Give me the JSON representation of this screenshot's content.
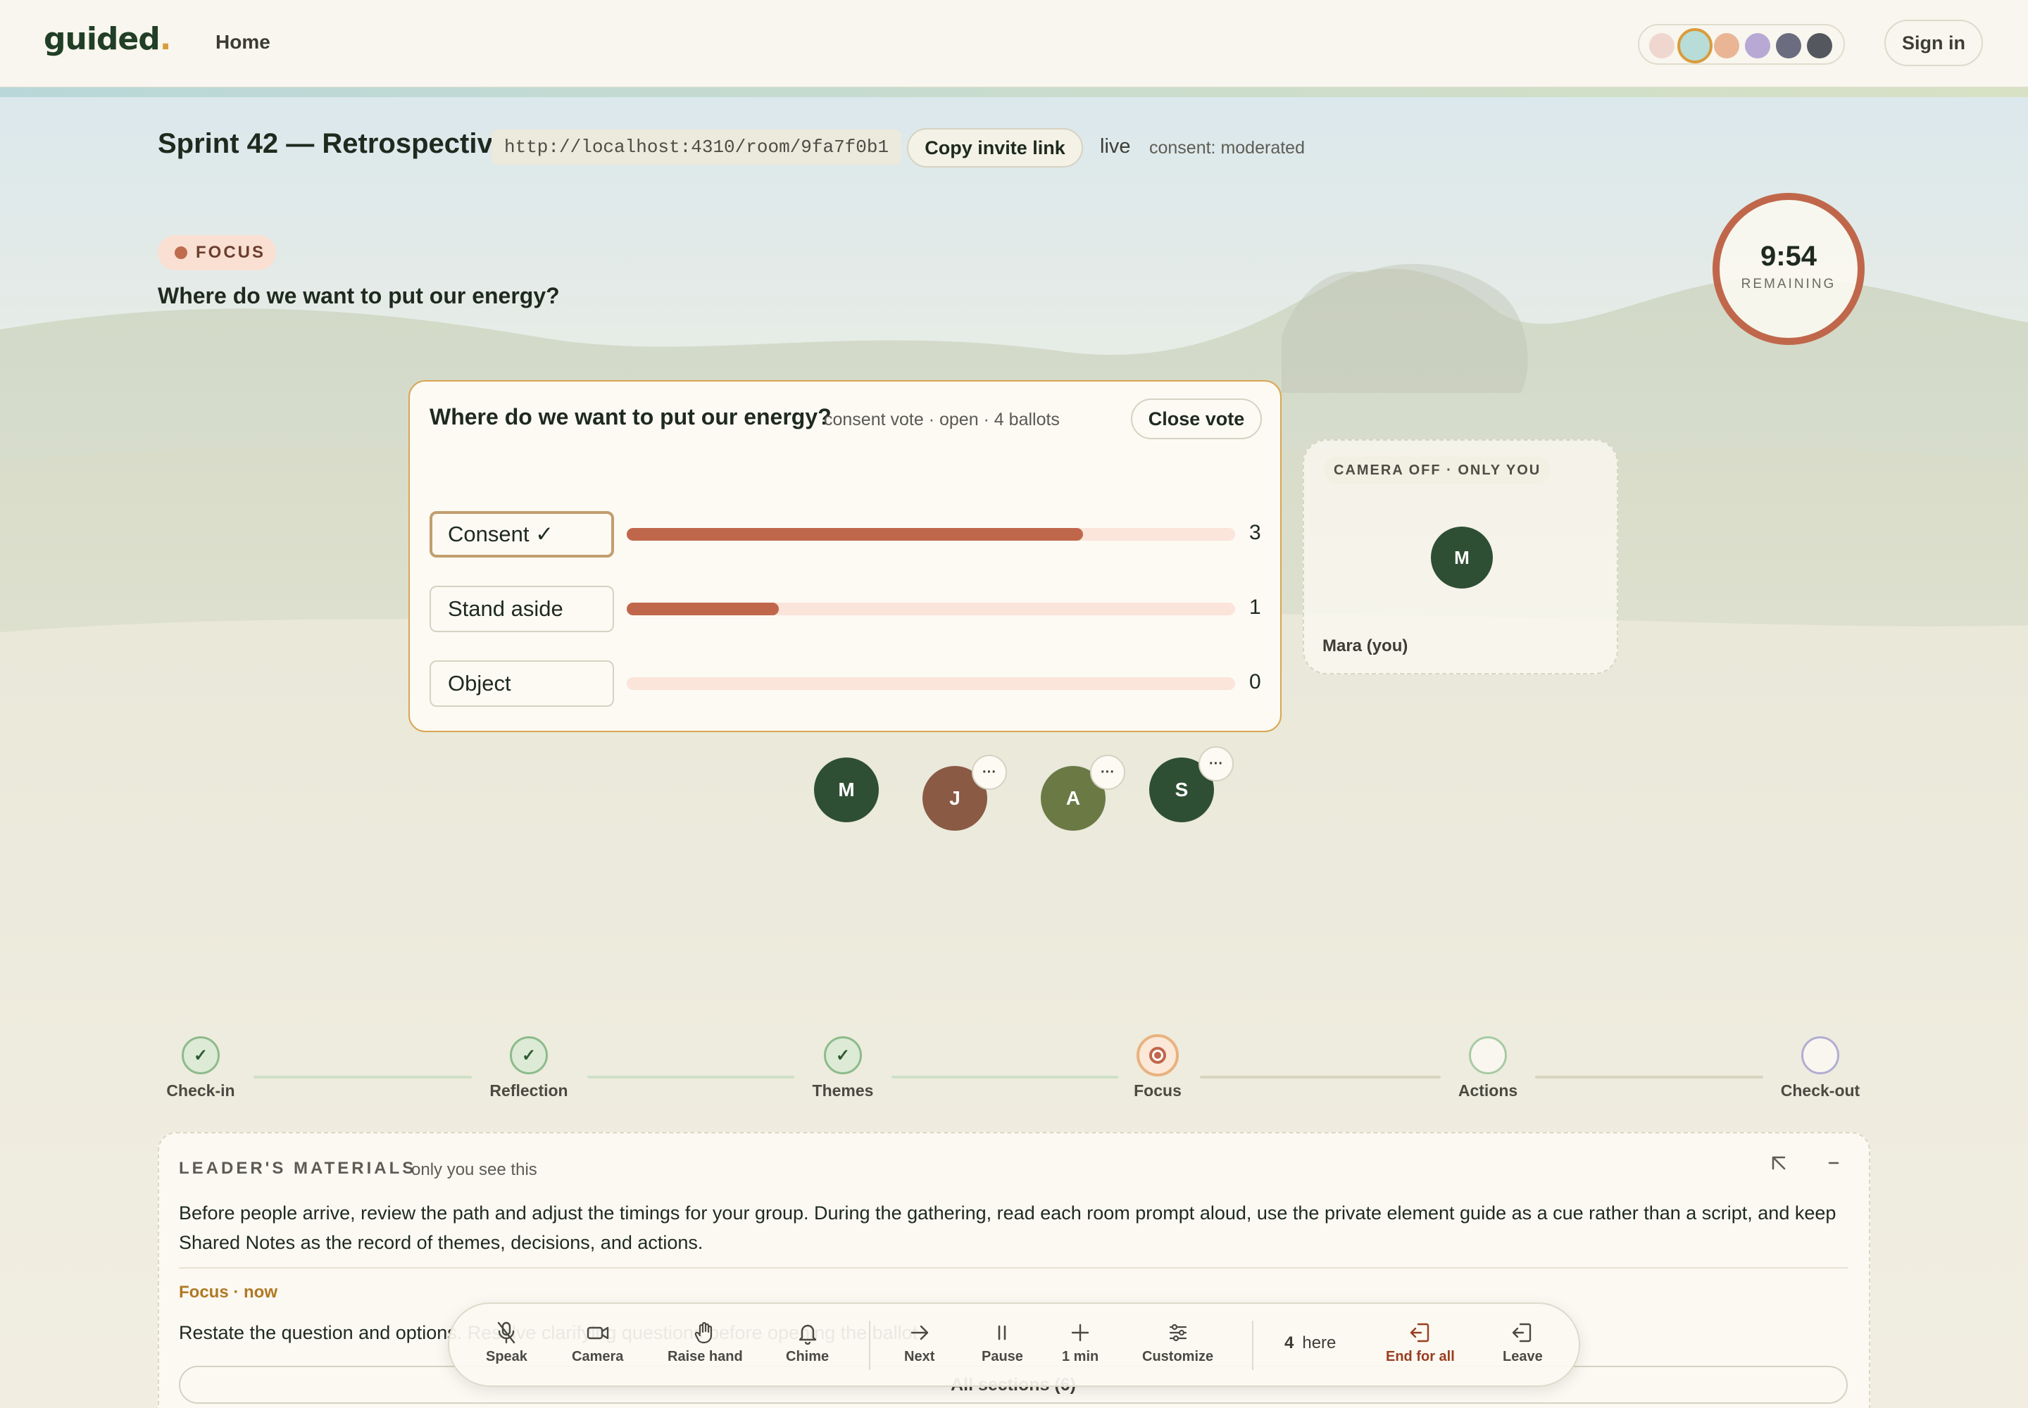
{
  "header": {
    "logo": "guided",
    "logo_dot": ".",
    "nav_home": "Home",
    "theme_swatches": [
      "#efd7cf",
      "#b8ddd8",
      "#e9b595",
      "#b7a9d4",
      "#6c6c80",
      "#54585e"
    ],
    "selected_swatch_index": 1,
    "sign_in": "Sign in"
  },
  "room": {
    "title": "Sprint 42 — Retrospective",
    "url": "http://localhost:4310/room/9fa7f0b1",
    "copy_invite": "Copy invite link",
    "status": "live",
    "consent_mode": "consent: moderated"
  },
  "stage": {
    "badge": "FOCUS",
    "prompt": "Where do we want to put our energy?",
    "timer": "9:54",
    "timer_label": "REMAINING",
    "timer_progress": 1.0
  },
  "vote": {
    "question": "Where do we want to put our energy?",
    "meta": "consent vote · open · 4 ballots",
    "close_label": "Close vote",
    "options": [
      {
        "label": "Consent ✓",
        "count": "3",
        "fraction": 0.75,
        "selected": true
      },
      {
        "label": "Stand aside",
        "count": "1",
        "fraction": 0.25,
        "selected": false
      },
      {
        "label": "Object",
        "count": "0",
        "fraction": 0,
        "selected": false
      }
    ]
  },
  "participants": [
    {
      "initial": "M",
      "color": "#2f4f34"
    },
    {
      "initial": "J",
      "color": "#8a5a45",
      "more": "···"
    },
    {
      "initial": "A",
      "color": "#6b7a45",
      "more": "···"
    },
    {
      "initial": "S",
      "color": "#2f4f34",
      "more": "···"
    }
  ],
  "self_camera": {
    "label": "CAMERA OFF · ONLY YOU",
    "initial": "M",
    "name": "Mara (you)"
  },
  "path": {
    "steps": [
      {
        "label": "Check-in",
        "state": "done",
        "mark": "✓"
      },
      {
        "label": "Reflection",
        "state": "done",
        "mark": "✓"
      },
      {
        "label": "Themes",
        "state": "done",
        "mark": "✓"
      },
      {
        "label": "Focus",
        "state": "current",
        "mark": ""
      },
      {
        "label": "Actions",
        "state": "todo",
        "mark": ""
      },
      {
        "label": "Check-out",
        "state": "todo",
        "mark": ""
      }
    ]
  },
  "materials": {
    "heading": "LEADER'S MATERIALS",
    "subheading": "only you see this",
    "body": "Before people arrive, review the path and adjust the timings for your group. During the gathering, read each room prompt aloud, use the private element guide as a cue rather than a script, and keep Shared Notes as the record of themes, decisions, and actions.",
    "section_label": "Focus · now",
    "section_text": "Restate the question and options. Resolve clarifying questions before opening the ballot.",
    "all_sections": "All sections (6)"
  },
  "dock": {
    "speak": "Speak",
    "camera": "Camera",
    "raise_hand": "Raise hand",
    "chime": "Chime",
    "next": "Next",
    "pause": "Pause",
    "add_min": "1 min",
    "customize": "Customize",
    "here_count": "4",
    "here_label": "here",
    "end_all": "End for all",
    "leave": "Leave"
  },
  "colors": {
    "accent": "#c0674b",
    "brand": "#213f26",
    "gold": "#d99c3c"
  }
}
